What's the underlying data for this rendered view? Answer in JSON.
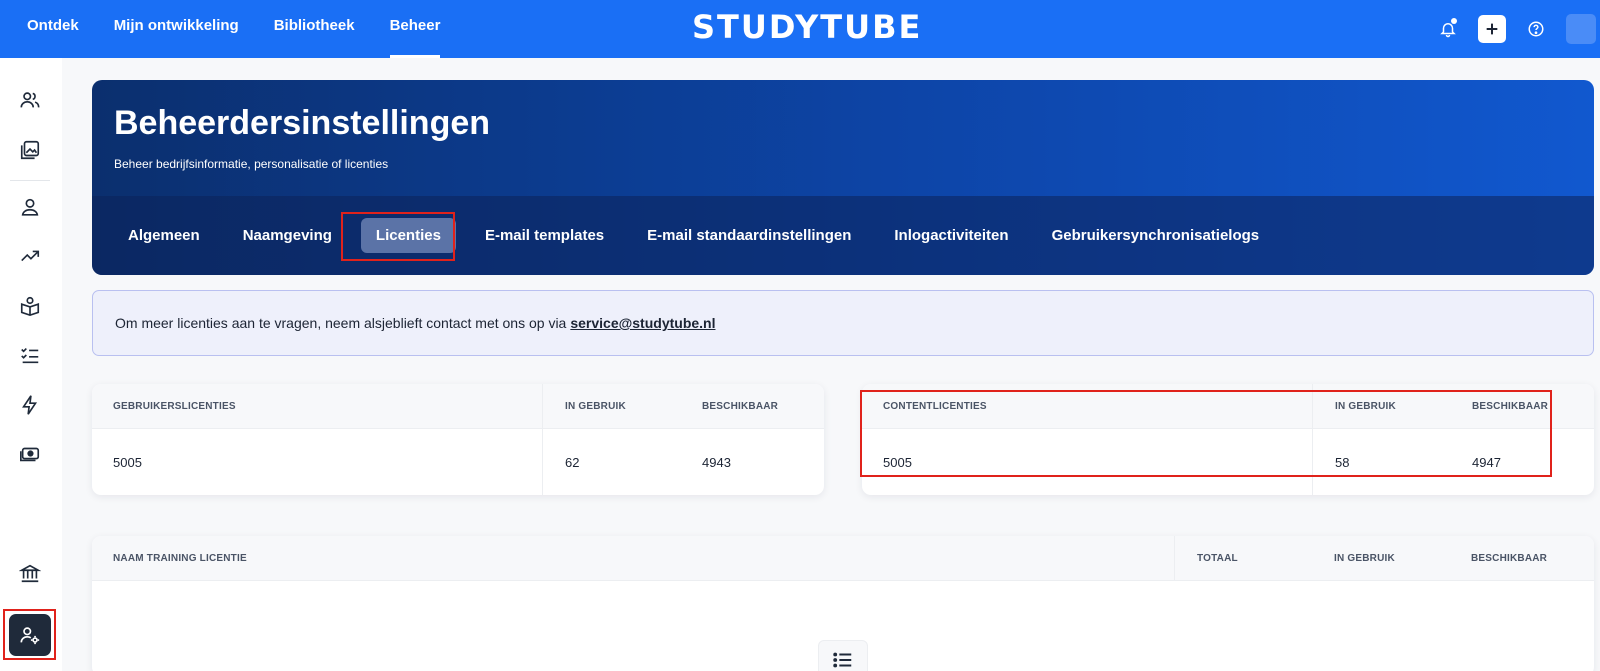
{
  "topnav": {
    "items": [
      "Ontdek",
      "Mijn ontwikkeling",
      "Bibliotheek",
      "Beheer"
    ],
    "active_index": 3
  },
  "logo": "STUDYTUBE",
  "icons": {
    "topbar": [
      "bell-icon",
      "plus-icon",
      "help-icon",
      "avatar"
    ],
    "sidebar": [
      "users-icon",
      "gallery-icon",
      "person-icon",
      "trending-icon",
      "book-icon",
      "checklist-icon",
      "lightning-icon",
      "money-icon",
      "bank-icon",
      "user-settings-icon"
    ]
  },
  "banner": {
    "title": "Beheerdersinstellingen",
    "subtitle": "Beheer bedrijfsinformatie, personalisatie of licenties",
    "tabs": [
      "Algemeen",
      "Naamgeving",
      "Licenties",
      "E-mail templates",
      "E-mail standaardinstellingen",
      "Inlogactiviteiten",
      "Gebruikersynchronisatielogs"
    ],
    "active_tab": "Licenties"
  },
  "info": {
    "text": "Om meer licenties aan te vragen, neem alsjeblieft contact met ons op via",
    "email": "service@studytube.nl"
  },
  "user_licenses": {
    "headers": [
      "GEBRUIKERSLICENTIES",
      "IN GEBRUIK",
      "BESCHIKBAAR"
    ],
    "values": [
      "5005",
      "62",
      "4943"
    ]
  },
  "content_licenses": {
    "headers": [
      "CONTENTLICENTIES",
      "IN GEBRUIK",
      "BESCHIKBAAR"
    ],
    "values": [
      "5005",
      "58",
      "4947"
    ]
  },
  "training_licenses": {
    "headers": [
      "NAAM TRAINING LICENTIE",
      "TOTAAL",
      "IN GEBRUIK",
      "BESCHIKBAAR"
    ]
  },
  "colors": {
    "primary": "#1a6ff5",
    "highlight": "#e0221b",
    "sidebar_active": "#1f2a3a"
  }
}
